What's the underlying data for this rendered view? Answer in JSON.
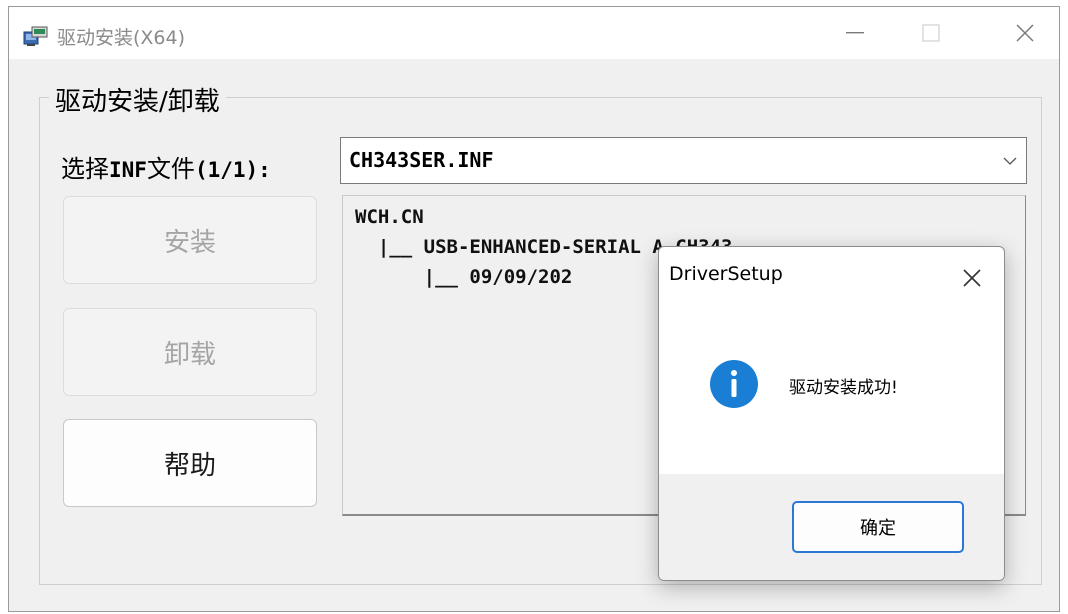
{
  "window": {
    "title": "驱动安装(X64)",
    "controls": {
      "minimize_icon": "minimize-icon",
      "maximize_icon": "maximize-icon",
      "close_icon": "close-icon"
    }
  },
  "group": {
    "label": "驱动安装/卸载"
  },
  "inf": {
    "label_prefix": "选择",
    "label_inf": "INF",
    "label_suffix": "文件",
    "label_count": "(1/1):",
    "selected": "CH343SER.INF"
  },
  "buttons": {
    "install": "安装",
    "uninstall": "卸载",
    "help": "帮助"
  },
  "tree": {
    "line1": "WCH.CN",
    "line2": "  |__ USB-ENHANCED-SERIAL A CH343",
    "line3": "      |__ 09/09/202"
  },
  "dialog": {
    "title": "DriverSetup",
    "message": "驱动安装成功!",
    "ok_label": "确定",
    "icon": "info-icon",
    "accent_color": "#1a7fd4"
  }
}
